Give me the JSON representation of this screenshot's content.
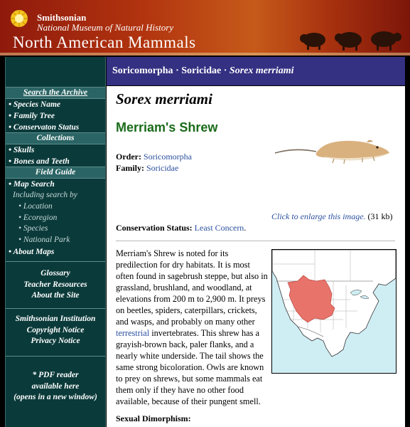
{
  "header": {
    "org_line1": "Smithsonian",
    "org_line2": "National Museum of Natural History",
    "site_title": "North American Mammals"
  },
  "breadcrumb": {
    "order": "Soricomorpha",
    "separator": "·",
    "family": "Soricidae",
    "species": "Sorex merriami"
  },
  "sidebar": {
    "archive_heading": "Search the Archive",
    "archive_items": [
      "• Species Name",
      "• Family Tree",
      "• Conservaton Status"
    ],
    "collections_heading": "Collections",
    "collections_items": [
      "• Skulls",
      "• Bones and Teeth"
    ],
    "field_heading": "Field Guide",
    "field_item": "• Map Search",
    "field_including": "Including search by",
    "field_subitems": [
      "• Location",
      "• Ecoregion",
      "• Species",
      "• National Park"
    ],
    "field_maps": "• About Maps",
    "resources": [
      "Glossary",
      "Teacher Resources",
      "About the Site"
    ],
    "smithsonian": [
      "Smithsonian Institution",
      "Copyright Notice",
      "Privacy Notice"
    ],
    "pdf": [
      "* PDF reader",
      "available here",
      "(opens in a new window)"
    ]
  },
  "species": {
    "scientific_name": "Sorex merriami",
    "common_name": "Merriam's Shrew",
    "order_label": "Order:",
    "order_value": "Soricomorpha",
    "family_label": "Family:",
    "family_value": "Soricidae",
    "conservation_label": "Conservation Status:",
    "conservation_value": "Least Concern",
    "image_caption_link": "Click to enlarge this image.",
    "image_caption_size": "(31 kb)",
    "description_1": "Merriam's Shrew is noted for its predilection for dry habitats. It is most often found in sagebrush steppe, but also in grassland, brushland, and woodland, at elevations from 200 m to 2,900 m. It preys on beetles, spiders, caterpillars, crickets, and wasps, and probably on many other ",
    "description_link": "terrestrial",
    "description_2": " invertebrates. This shrew has a grayish-brown back, paler flanks, and a nearly white underside. The tail shows the same strong bicoloration. Owls are known to prey on shrews, but some mammals eat them only if they have no other food available, because of their pungent smell.",
    "sexual_dimorphism_heading": "Sexual Dimorphism:"
  },
  "colors": {
    "sidebar_bg": "#0b3a3a",
    "breadcrumb_bg": "#343082",
    "common_name": "#1a6b1a",
    "link": "#2a4f9e",
    "map_range": "#e8736a"
  }
}
